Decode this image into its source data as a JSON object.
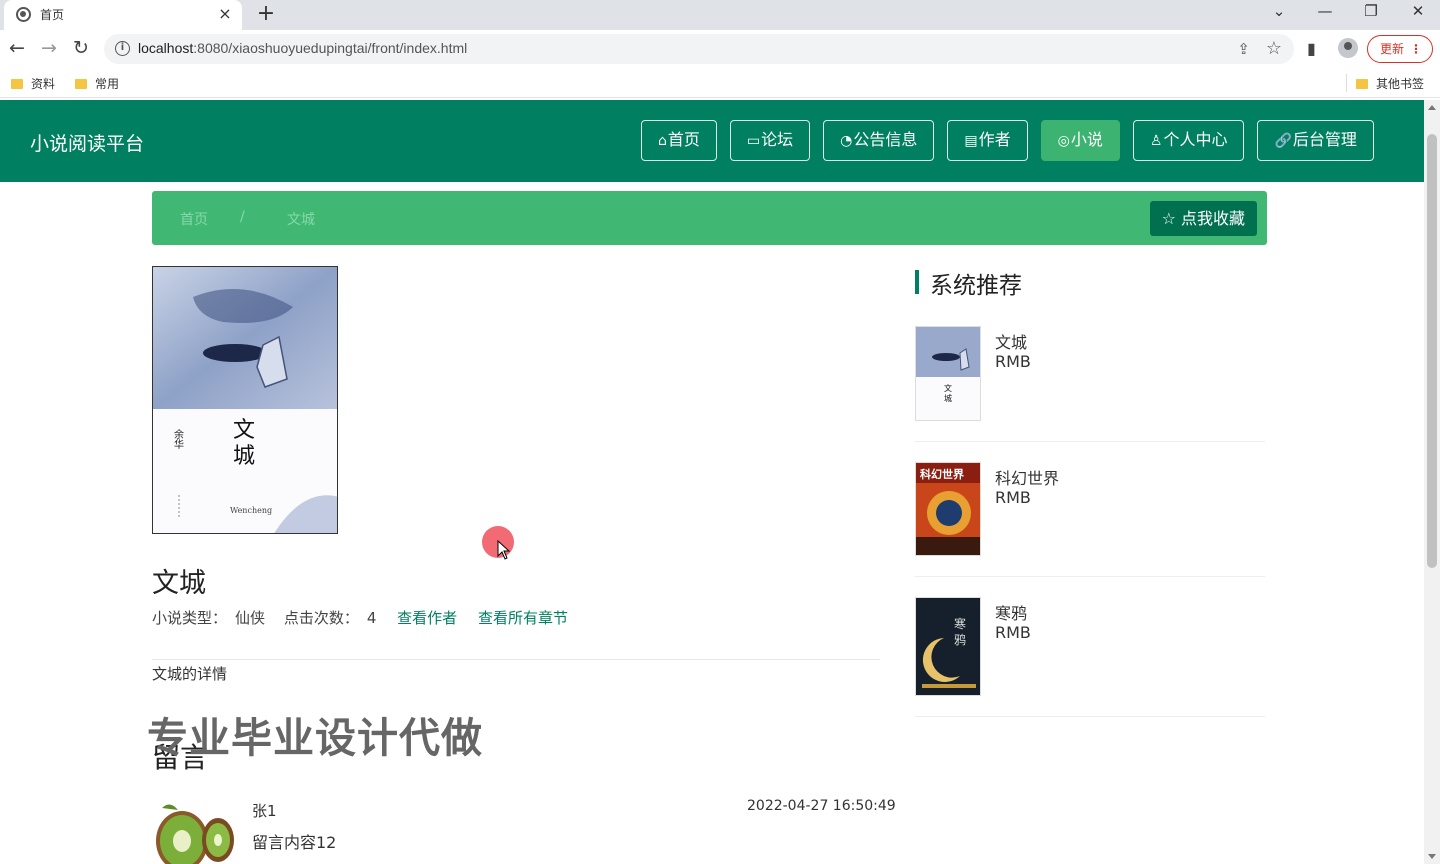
{
  "browser": {
    "tab_title": "首页",
    "tab_close": "×",
    "new_tab": "+",
    "url_host": "localhost",
    "url_path": ":8080/xiaoshuoyuedupingtai/front/index.html",
    "update_label": "更新",
    "window_controls": [
      "⌄",
      "—",
      "❐",
      "✕"
    ],
    "bookmarks": [
      "资料",
      "常用"
    ],
    "other_bookmarks": "其他书签"
  },
  "site": {
    "title": "小说阅读平台",
    "nav": [
      {
        "icon": "⌂",
        "label": "首页"
      },
      {
        "icon": "▭",
        "label": "论坛"
      },
      {
        "icon": "◔",
        "label": "公告信息"
      },
      {
        "icon": "▤",
        "label": "作者"
      },
      {
        "icon": "◎",
        "label": "小说"
      },
      {
        "icon": "♙",
        "label": "个人中心"
      },
      {
        "icon": "🔗",
        "label": "后台管理"
      }
    ],
    "active_nav": "小说"
  },
  "breadcrumb": {
    "home": "首页",
    "separator": "/",
    "current": "文城"
  },
  "favorite_button": "☆ 点我收藏",
  "book": {
    "title": "文城",
    "type_label": "小说类型：",
    "type_value": "仙侠",
    "clicks_label": "点击次数：",
    "clicks_value": "4",
    "view_author": "查看作者",
    "view_chapters": "查看所有章节",
    "detail": "文城的详情",
    "cover": {
      "author": "余华",
      "title_line1": "文",
      "title_line2": "城",
      "subtitle": "Wencheng"
    }
  },
  "watermark": "专业毕业设计代做",
  "comments": {
    "title": "留言",
    "items": [
      {
        "user": "张1",
        "content": "留言内容12",
        "time": "2022-04-27 16:50:49"
      }
    ]
  },
  "recommend": {
    "title": "系统推荐",
    "items": [
      {
        "name": "文城",
        "price": "RMB"
      },
      {
        "name": "科幻世界",
        "price": "RMB"
      },
      {
        "name": "寒鸦",
        "price": "RMB"
      }
    ]
  },
  "colors": {
    "header": "#008060",
    "breadcrumb_bar": "#40b874",
    "active_nav": "#3cb371",
    "link": "#008060"
  }
}
